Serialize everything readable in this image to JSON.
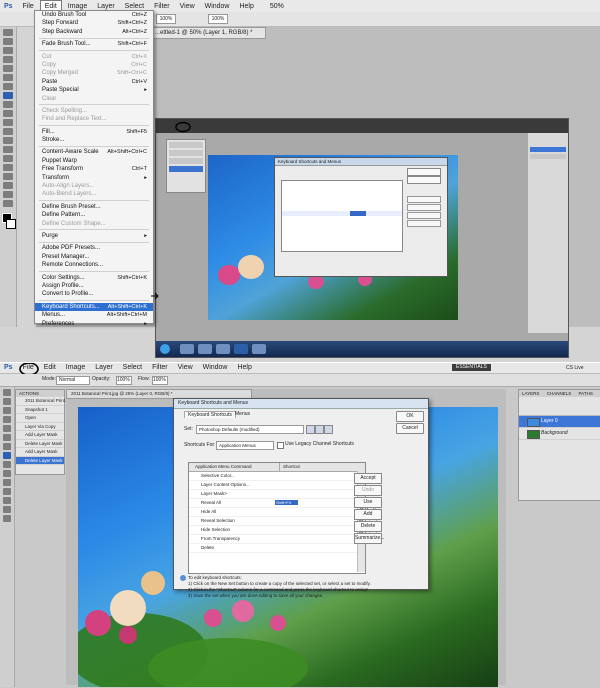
{
  "top": {
    "menu": [
      "Ps",
      "File",
      "Edit",
      "Image",
      "Layer",
      "Select",
      "Filter",
      "View",
      "Window",
      "Help"
    ],
    "options_bar": {
      "opacity": "100%",
      "flow": "100%",
      "zoom": "50%"
    },
    "doc_tab": "...ettled-1 @ 50% (Layer 1, RGB/8) *",
    "edit_menu": [
      {
        "label": "Undo Brush Tool",
        "shortcut": "Ctrl+Z"
      },
      {
        "label": "Step Forward",
        "shortcut": "Shift+Ctrl+Z"
      },
      {
        "label": "Step Backward",
        "shortcut": "Alt+Ctrl+Z"
      },
      {
        "sep": true
      },
      {
        "label": "Fade Brush Tool...",
        "shortcut": "Shift+Ctrl+F"
      },
      {
        "sep": true
      },
      {
        "label": "Cut",
        "shortcut": "Ctrl+X",
        "disabled": true
      },
      {
        "label": "Copy",
        "shortcut": "Ctrl+C",
        "disabled": true
      },
      {
        "label": "Copy Merged",
        "shortcut": "Shift+Ctrl+C",
        "disabled": true
      },
      {
        "label": "Paste",
        "shortcut": "Ctrl+V"
      },
      {
        "label": "Paste Special",
        "shortcut": "▸"
      },
      {
        "label": "Clear",
        "shortcut": "",
        "disabled": true
      },
      {
        "sep": true
      },
      {
        "label": "Check Spelling...",
        "shortcut": "",
        "disabled": true
      },
      {
        "label": "Find and Replace Text...",
        "shortcut": "",
        "disabled": true
      },
      {
        "sep": true
      },
      {
        "label": "Fill...",
        "shortcut": "Shift+F5"
      },
      {
        "label": "Stroke...",
        "shortcut": ""
      },
      {
        "sep": true
      },
      {
        "label": "Content-Aware Scale",
        "shortcut": "Alt+Shift+Ctrl+C"
      },
      {
        "label": "Puppet Warp",
        "shortcut": ""
      },
      {
        "label": "Free Transform",
        "shortcut": "Ctrl+T"
      },
      {
        "label": "Transform",
        "shortcut": "▸"
      },
      {
        "label": "Auto-Align Layers...",
        "shortcut": "",
        "disabled": true
      },
      {
        "label": "Auto-Blend Layers...",
        "shortcut": "",
        "disabled": true
      },
      {
        "sep": true
      },
      {
        "label": "Define Brush Preset...",
        "shortcut": ""
      },
      {
        "label": "Define Pattern...",
        "shortcut": ""
      },
      {
        "label": "Define Custom Shape...",
        "shortcut": "",
        "disabled": true
      },
      {
        "sep": true
      },
      {
        "label": "Purge",
        "shortcut": "▸"
      },
      {
        "sep": true
      },
      {
        "label": "Adobe PDF Presets...",
        "shortcut": ""
      },
      {
        "label": "Preset Manager...",
        "shortcut": ""
      },
      {
        "label": "Remote Connections...",
        "shortcut": ""
      },
      {
        "sep": true
      },
      {
        "label": "Color Settings...",
        "shortcut": "Shift+Ctrl+K"
      },
      {
        "label": "Assign Profile...",
        "shortcut": ""
      },
      {
        "label": "Convert to Profile...",
        "shortcut": ""
      },
      {
        "sep": true
      },
      {
        "label": "Keyboard Shortcuts...",
        "shortcut": "Alt+Shift+Ctrl+K",
        "selected": true
      },
      {
        "label": "Menus...",
        "shortcut": "Alt+Shift+Ctrl+M"
      },
      {
        "label": "Preferences",
        "shortcut": "▸"
      }
    ]
  },
  "bottom": {
    "menu": [
      "Ps",
      "File",
      "Edit",
      "Image",
      "Layer",
      "Select",
      "Filter",
      "View",
      "Window",
      "Help"
    ],
    "workspace": "ESSENTIALS",
    "cs_live": "CS Live",
    "options_bar": {
      "mode_label": "Mode:",
      "mode_value": "Normal",
      "opacity_label": "Opacity:",
      "opacity_value": "100%",
      "flow_label": "Flow:",
      "flow_value": "100%"
    },
    "doc_tab": "2011 Botanical Print.jpg @ 25% (Layer 0, RGB/8) *",
    "actions_panel": {
      "title": "ACTIONS",
      "rows": [
        "2011 Botanical Print.psd",
        "Snapshot 1",
        "Open",
        "Layer Via Copy",
        "Add Layer Mask",
        "Delete Layer Mask",
        "Add Layer Mask",
        "Delete Layer Mask"
      ],
      "selected_index": 7
    },
    "layers_panel": {
      "title": "LAYERS",
      "tabs": [
        "LAYERS",
        "CHANNELS",
        "PATHS"
      ],
      "rows": [
        {
          "name": "Layer 0",
          "selected": true
        },
        {
          "name": "Background",
          "selected": false
        }
      ]
    },
    "dialog": {
      "title": "Keyboard Shortcuts and Menus",
      "tabs": [
        "Keyboard Shortcuts",
        "Menus"
      ],
      "set_label": "Set:",
      "set_value": "Photoshop Defaults (modified)",
      "legacy_label": "Use Legacy Channel Shortcuts",
      "shortcuts_for_label": "Shortcuts For:",
      "shortcuts_for_value": "Application Menus",
      "col_command": "Application Menu Command",
      "col_shortcut": "Shortcut",
      "rows": [
        "Selective Color...",
        "Layer Content Options...",
        "Layer Mask>",
        "Reveal All",
        "Hide All",
        "Reveal Selection",
        "Hide Selection",
        "From Transparency",
        "Delete"
      ],
      "selected_row": "Reveal All",
      "selected_shortcut": "Shift+F4",
      "buttons": [
        "OK",
        "Cancel"
      ],
      "side_buttons": [
        "Accept",
        "Undo",
        "Use Default",
        "Add Shortcut",
        "Delete Shortcut",
        "Summarize..."
      ],
      "notes_title": "To edit keyboard shortcuts:",
      "notes": [
        "1) Click on the New Set button to create a copy of the selected set, or select a set to modify.",
        "2) Click in the \"Shortcut\" column for a command and press the keyboard shortcut to assign.",
        "3) Save the set when you are done editing to save all your changes."
      ]
    }
  }
}
